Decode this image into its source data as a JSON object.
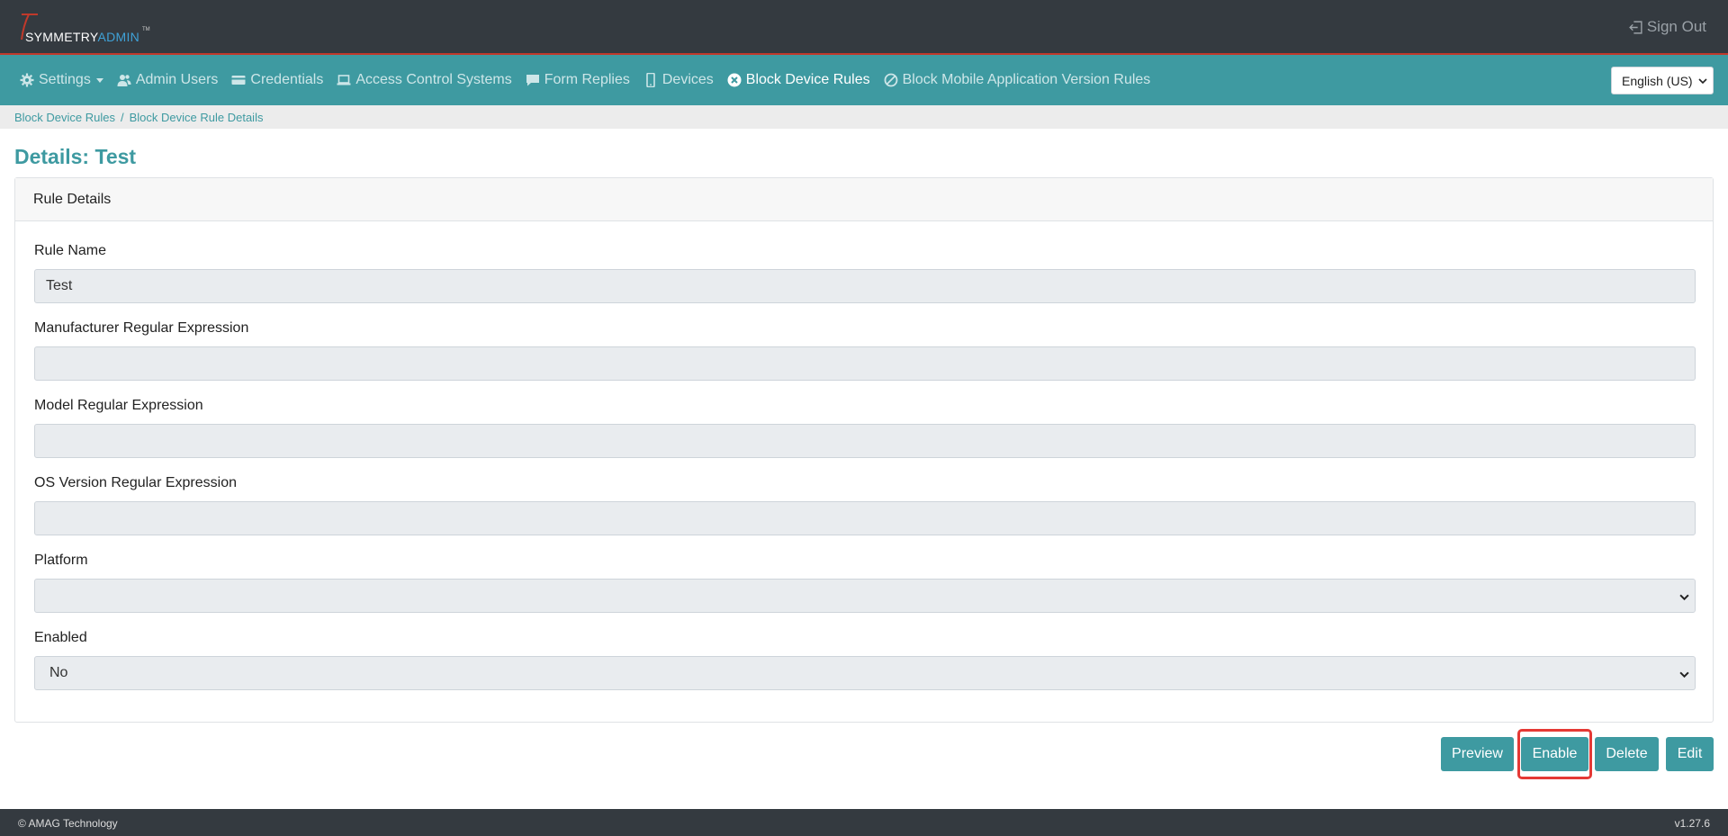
{
  "app": {
    "logo_part1": "SYMMETRY",
    "logo_part2": "ADMIN",
    "logo_tm": "TM",
    "sign_out": "Sign Out"
  },
  "nav": {
    "items": [
      {
        "label": "Settings",
        "icon": "gear-icon"
      },
      {
        "label": "Admin Users",
        "icon": "users-icon"
      },
      {
        "label": "Credentials",
        "icon": "card-icon"
      },
      {
        "label": "Access Control Systems",
        "icon": "laptop-icon"
      },
      {
        "label": "Form Replies",
        "icon": "comment-icon"
      },
      {
        "label": "Devices",
        "icon": "mobile-icon"
      },
      {
        "label": "Block Device Rules",
        "icon": "times-circle-icon"
      },
      {
        "label": "Block Mobile Application Version Rules",
        "icon": "ban-icon"
      }
    ],
    "language": "English (US)"
  },
  "breadcrumb": {
    "items": [
      "Block Device Rules",
      "Block Device Rule Details"
    ],
    "separator": "/"
  },
  "page": {
    "title": "Details: Test"
  },
  "card": {
    "header": "Rule Details",
    "fields": [
      {
        "label": "Rule Name",
        "value": "Test",
        "type": "input"
      },
      {
        "label": "Manufacturer Regular Expression",
        "value": "",
        "type": "input"
      },
      {
        "label": "Model Regular Expression",
        "value": "",
        "type": "input"
      },
      {
        "label": "OS Version Regular Expression",
        "value": "",
        "type": "input"
      },
      {
        "label": "Platform",
        "value": "",
        "type": "select"
      },
      {
        "label": "Enabled",
        "value": "No",
        "type": "select"
      }
    ]
  },
  "actions": {
    "preview": "Preview",
    "enable": "Enable",
    "delete": "Delete",
    "edit": "Edit"
  },
  "footer": {
    "copyright": "© AMAG Technology",
    "version": "v1.27.6"
  },
  "colors": {
    "topbar": "#343a40",
    "accent": "#3e9aa1",
    "highlight": "#e53935"
  }
}
